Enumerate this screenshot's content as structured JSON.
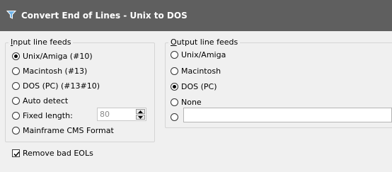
{
  "window": {
    "title": "Convert End of Lines - Unix to DOS",
    "icon": "filter-icon"
  },
  "input_group": {
    "label": "Input line feeds",
    "options": [
      {
        "label": "Unix/Amiga (#10)",
        "selected": true
      },
      {
        "label": "Macintosh (#13)",
        "selected": false
      },
      {
        "label": "DOS (PC) (#13#10)",
        "selected": false
      },
      {
        "label": "Auto detect",
        "selected": false
      },
      {
        "label": "Fixed length:",
        "selected": false
      },
      {
        "label": "Mainframe CMS Format",
        "selected": false
      }
    ],
    "fixed_length_value": "80"
  },
  "output_group": {
    "label": "Output line feeds",
    "options": [
      {
        "label": "Unix/Amiga",
        "selected": false
      },
      {
        "label": "Macintosh",
        "selected": false
      },
      {
        "label": "DOS (PC)",
        "selected": true
      },
      {
        "label": "None",
        "selected": false
      }
    ],
    "custom_value": ""
  },
  "remove_bad_eols": {
    "label": "Remove bad EOLs",
    "checked": true
  }
}
